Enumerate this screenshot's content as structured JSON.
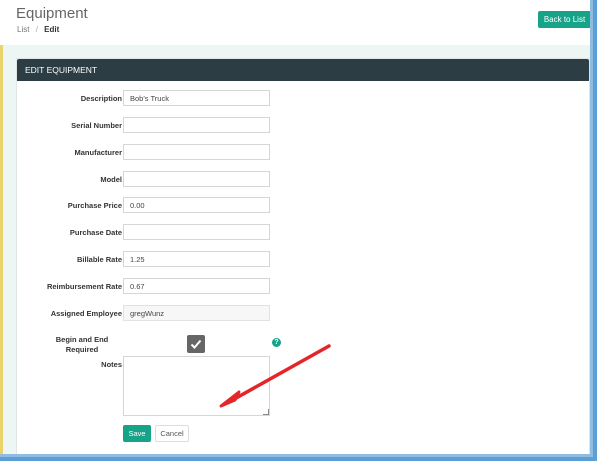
{
  "header": {
    "title": "Equipment",
    "breadcrumb": {
      "list": "List",
      "separator": "/",
      "current": "Edit"
    },
    "back_button": "Back to List"
  },
  "panel": {
    "title": "EDIT EQUIPMENT"
  },
  "form": {
    "description": {
      "label": "Description",
      "value": "Bob's Truck"
    },
    "serial_number": {
      "label": "Serial Number",
      "value": ""
    },
    "manufacturer": {
      "label": "Manufacturer",
      "value": ""
    },
    "model": {
      "label": "Model",
      "value": ""
    },
    "purchase_price": {
      "label": "Purchase Price",
      "value": "0.00"
    },
    "purchase_date": {
      "label": "Purchase Date",
      "value": ""
    },
    "billable_rate": {
      "label": "Billable Rate",
      "value": "1.25"
    },
    "reimbursement_rate": {
      "label": "Reimbursement Rate",
      "value": "0.67"
    },
    "assigned_employee": {
      "label": "Assigned Employee",
      "value": "gregWunz"
    },
    "begin_end_required": {
      "label_line1": "Begin and End",
      "label_line2": "Required",
      "checked": true
    },
    "notes": {
      "label": "Notes",
      "value": ""
    },
    "help_glyph": "?"
  },
  "buttons": {
    "save": "Save",
    "cancel": "Cancel"
  },
  "colors": {
    "accent": "#17a388",
    "panel_header": "#2c3e44",
    "annotation_arrow": "#e3262a"
  }
}
